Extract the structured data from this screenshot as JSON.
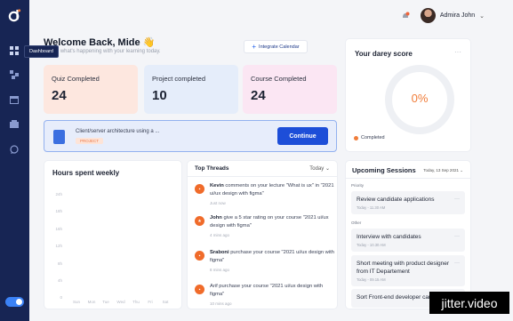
{
  "sidebar": {
    "tooltip": "Dashboard",
    "nav_items": [
      "dashboard-icon",
      "courses-icon",
      "calendar-icon",
      "library-icon",
      "chat-icon"
    ]
  },
  "header": {
    "user_name": "Admira John"
  },
  "welcome": {
    "title": "Welcome Back, Mide 👋",
    "subtitle": "Here's what's happening with your learning today.",
    "integrate_label": "Integrate Calendar"
  },
  "stats": [
    {
      "label": "Quiz Completed",
      "value": "24"
    },
    {
      "label": "Project completed",
      "value": "10"
    },
    {
      "label": "Course Completed",
      "value": "24"
    }
  ],
  "current_course": {
    "title": "Client/server architecture using a ...",
    "tag": "PROJECT",
    "button": "Continue"
  },
  "score": {
    "title": "Your darey score",
    "percent_label": "0%",
    "percent": 0,
    "legend": "Completed",
    "accent": "#f07d3a"
  },
  "hours": {
    "title": "Hours spent weekly",
    "y_ticks": [
      "24h",
      "18h",
      "16h",
      "12h",
      "8h",
      "4h",
      "0"
    ],
    "x_ticks": [
      "Sun",
      "Mon",
      "Tue",
      "Wed",
      "Thu",
      "Fri",
      "Sat"
    ]
  },
  "threads": {
    "title": "Top Threads",
    "filter": "Today",
    "items": [
      {
        "name": "Kevin",
        "text": " comments on your lecture \"What is ux\" in \"2021 ui/ux design with figma\"",
        "time": "Just now"
      },
      {
        "name": "John",
        "text": " give a 5 star rating on your course \"2021 ui/ux design with figma\"",
        "time": "4 mins ago"
      },
      {
        "name": "Sraboni",
        "text": " purchase your course \"2021 ui/ux design with figma\"",
        "time": "8 mins ago"
      },
      {
        "name": "",
        "text": "Arif purchase your course \"2021 ui/ux design with figma\"",
        "time": "10 mins ago"
      }
    ]
  },
  "sessions": {
    "title": "Upcoming Sessions",
    "date": "Today, 13 Sep 2021",
    "group_priority": "Priority",
    "group_other": "Other",
    "items": [
      {
        "title": "Review candidate applications",
        "time": "Today - 11.30 AM"
      },
      {
        "title": "Interview with candidates",
        "time": "Today - 10.30 AM"
      },
      {
        "title": "Short meeting with product designer from IT Departement",
        "time": "Today - 09.15 AM"
      },
      {
        "title": "Sort Front-end developer candidates",
        "time": ""
      }
    ]
  },
  "watermark": "jitter.video"
}
